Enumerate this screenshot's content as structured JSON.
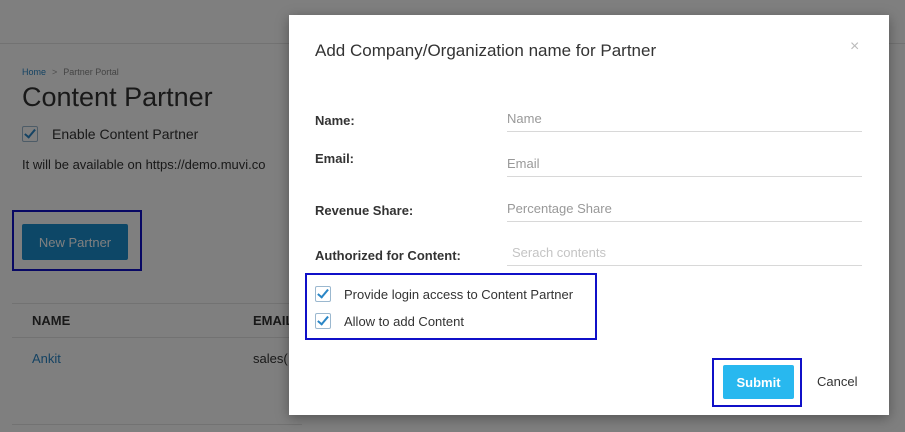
{
  "background": {
    "breadcrumb": {
      "home": "Home",
      "separator": ">",
      "current": "Partner Portal"
    },
    "page_title": "Content Partner",
    "enable_checkbox": {
      "label": "Enable Content Partner",
      "checked": true
    },
    "availability_text": "It will be available on https://demo.muvi.co",
    "new_partner_button": "New Partner",
    "table": {
      "headers": [
        "NAME",
        "EMAIL"
      ],
      "rows": [
        {
          "name": "Ankit",
          "email": "sales("
        }
      ]
    }
  },
  "modal": {
    "title": "Add Company/Organization name for Partner",
    "close_symbol": "×",
    "fields": {
      "name": {
        "label": "Name:",
        "placeholder": "Name",
        "value": ""
      },
      "email": {
        "label": "Email:",
        "placeholder": "Email",
        "value": ""
      },
      "revenue_share": {
        "label": "Revenue Share:",
        "placeholder": "Percentage Share",
        "value": ""
      },
      "authorized_content": {
        "label": "Authorized for Content:",
        "placeholder": "Serach contents",
        "value": ""
      }
    },
    "checkboxes": {
      "login_access": {
        "label": "Provide login access to Content Partner",
        "checked": true
      },
      "add_content": {
        "label": "Allow to add Content",
        "checked": true
      }
    },
    "submit_label": "Submit",
    "cancel_label": "Cancel"
  },
  "colors": {
    "primary_button": "#1b8fcf",
    "submit_button": "#28b8ef",
    "link": "#2a86c6",
    "highlight_box": "#1010c8"
  }
}
